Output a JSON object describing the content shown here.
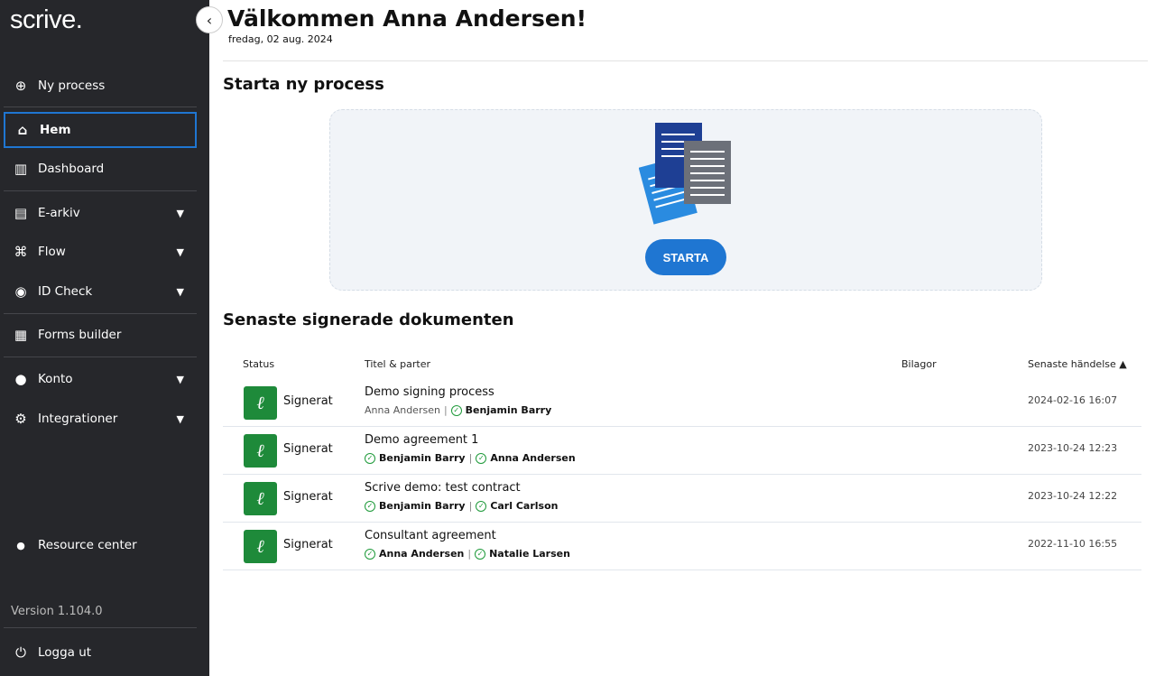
{
  "sidebar": {
    "logo": "scrive.",
    "items": [
      {
        "label": "Ny process",
        "icon": "plus-circle-icon"
      },
      {
        "label": "Hem",
        "icon": "home-icon"
      },
      {
        "label": "Dashboard",
        "icon": "bar-chart-icon"
      },
      {
        "label": "E-arkiv",
        "icon": "archive-icon"
      },
      {
        "label": "Flow",
        "icon": "flow-icon"
      },
      {
        "label": "ID Check",
        "icon": "fingerprint-icon"
      },
      {
        "label": "Forms builder",
        "icon": "grid-icon"
      },
      {
        "label": "Konto",
        "icon": "user-icon"
      },
      {
        "label": "Integrationer",
        "icon": "gear-icon"
      }
    ],
    "resource_center": "Resource center",
    "version": "Version 1.104.0",
    "logout": "Logga ut"
  },
  "header": {
    "title": "Välkommen Anna Andersen!",
    "date": "fredag, 02 aug. 2024"
  },
  "start": {
    "heading": "Starta ny process",
    "button": "STARTA"
  },
  "recent": {
    "heading": "Senaste signerade dokumenten",
    "columns": [
      "Status",
      "Titel & parter",
      "Bilagor",
      "Senaste händelse"
    ],
    "rows": [
      {
        "status": "Signerat",
        "title": "Demo signing process",
        "p1": "Anna Andersen",
        "p2": "Benjamin Barry",
        "time": "2024-02-16 16:07"
      },
      {
        "status": "Signerat",
        "title": "Demo agreement 1",
        "p1": "Benjamin Barry",
        "p2": "Anna Andersen",
        "time": "2023-10-24 12:23"
      },
      {
        "status": "Signerat",
        "title": "Scrive demo: test contract",
        "p1": "Benjamin Barry",
        "p2": "Carl Carlson",
        "time": "2023-10-24 12:22"
      },
      {
        "status": "Signerat",
        "title": "Consultant agreement",
        "p1": "Anna Andersen",
        "p2": "Natalie Larsen",
        "time": "2022-11-10 16:55"
      }
    ]
  }
}
